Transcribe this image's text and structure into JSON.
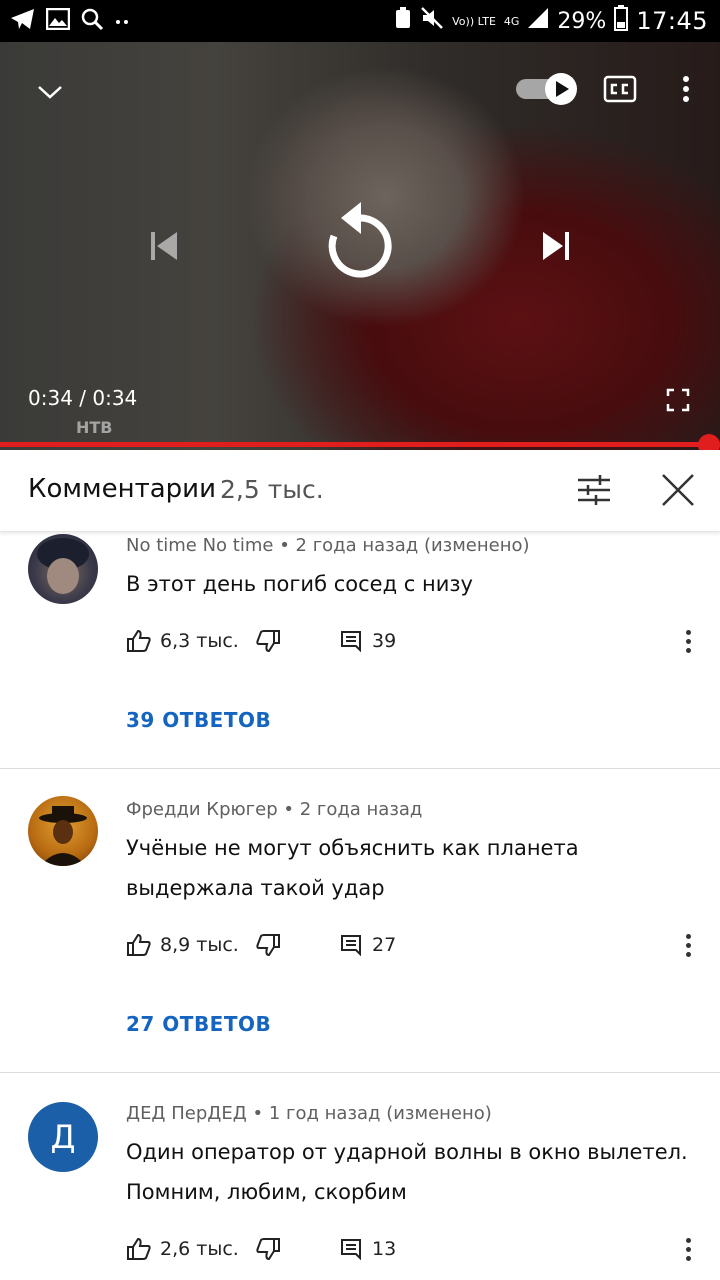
{
  "status_bar": {
    "left_icons": [
      "telegram-icon",
      "gallery-icon",
      "search-icon",
      "more-dots-icon"
    ],
    "right_icons": [
      "recycle-icon",
      "mute-icon",
      "volte-icon",
      "4g-icon",
      "signal-icon",
      "battery-icon"
    ],
    "volte_label": "Vo)) LTE",
    "network_label": "4G",
    "battery_percent": "29%",
    "time": "17:45"
  },
  "video": {
    "time_display": "0:34 / 0:34",
    "channel_logo": "НТВ",
    "progress_fraction": 1.0,
    "autoplay_on": true
  },
  "comments_header": {
    "title": "Комментарии",
    "count": "2,5 тыс."
  },
  "comments": [
    {
      "author": "No time No time",
      "age": "2 года назад (изменено)",
      "text": "В этот день погиб сосед с низу",
      "likes": "6,3 тыс.",
      "reply_count": "39",
      "replies_link": "39 ОТВЕТОВ"
    },
    {
      "author": "Фредди Крюгер",
      "age": "2 года назад",
      "text": "Учёные не могут объяснить как планета выдержала такой удар",
      "likes": "8,9 тыс.",
      "reply_count": "27",
      "replies_link": "27 ОТВЕТОВ"
    },
    {
      "author": "ДЕД ПерДЕД",
      "age": "1 год назад (изменено)",
      "text": "Один оператор от ударной волны в окно вылетел. Помним, любим, скорбим",
      "likes": "2,6 тыс.",
      "reply_count": "13",
      "avatar_letter": "Д"
    }
  ],
  "colors": {
    "accent_red": "#e01e1e",
    "link_blue": "#1565c0",
    "avatar_blue": "#1a5fa8"
  }
}
